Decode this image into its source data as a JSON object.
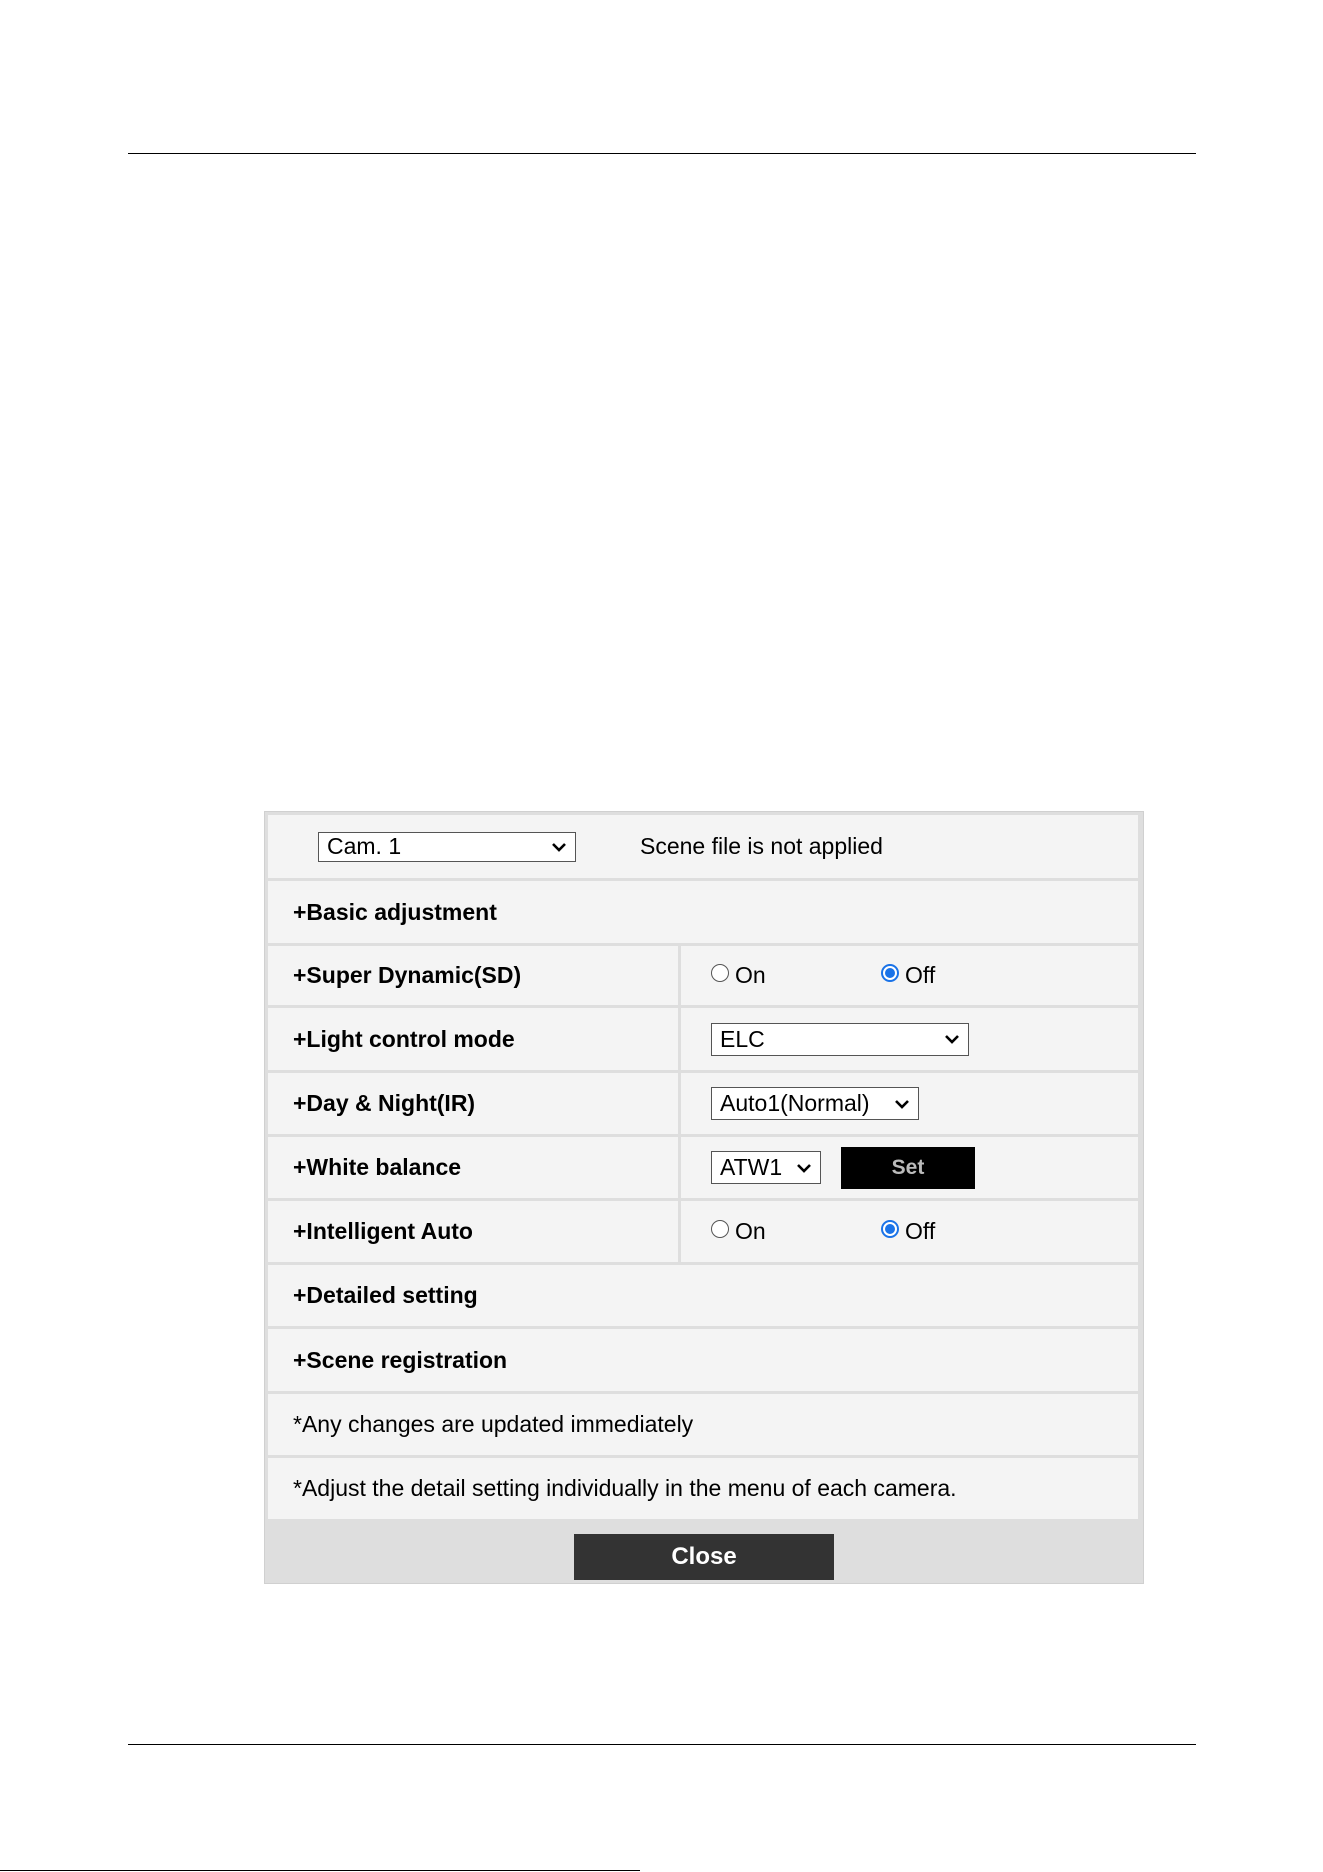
{
  "camera_select": {
    "value": "Cam. 1"
  },
  "scene_status": "Scene file is not applied",
  "sections": {
    "basic_adjustment": "+Basic adjustment",
    "super_dynamic": "+Super Dynamic(SD)",
    "light_control": "+Light control mode",
    "day_night": "+Day & Night(IR)",
    "white_balance": "+White balance",
    "intelligent_auto": "+Intelligent Auto",
    "detailed_setting": "+Detailed setting",
    "scene_registration": "+Scene registration"
  },
  "super_dynamic": {
    "on_label": "On",
    "off_label": "Off",
    "selected": "Off"
  },
  "light_control": {
    "value": "ELC"
  },
  "day_night": {
    "value": "Auto1(Normal)"
  },
  "white_balance": {
    "value": "ATW1",
    "set_label": "Set"
  },
  "intelligent_auto": {
    "on_label": "On",
    "off_label": "Off",
    "selected": "Off"
  },
  "notes": {
    "immediate": "*Any changes are updated immediately",
    "detail": "*Adjust the detail setting individually in the menu of each camera."
  },
  "close_label": "Close",
  "icons": {
    "dropdown": "chevron-down-icon"
  },
  "colors": {
    "radio_selected": "#1a73e8",
    "set_button": "#000000",
    "close_button": "#333333",
    "panel_bg": "#f4f4f4"
  }
}
